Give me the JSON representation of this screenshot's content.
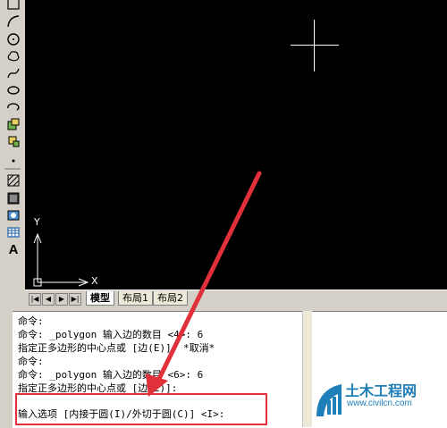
{
  "toolbar": {
    "items": [
      "line-icon",
      "arc-icon",
      "circle-icon",
      "cloud-icon",
      "spline-icon",
      "ellipse-icon",
      "ellipse-arc-icon",
      "insert-block-icon",
      "make-block-icon",
      "point-icon",
      "hatch-icon",
      "gradient-icon",
      "region-icon",
      "table-icon",
      "multiline-text-icon"
    ],
    "text_tool_label": "A"
  },
  "drawing": {
    "ucs_x_label": "X",
    "ucs_y_label": "Y",
    "background": "#000000"
  },
  "tabs": {
    "nav": [
      "|◀",
      "◀",
      "▶",
      "▶|"
    ],
    "items": [
      "模型",
      "布局1",
      "布局2"
    ],
    "active": "模型"
  },
  "command": {
    "lines": [
      "命令:",
      "命令: _polygon 输入边的数目 <4>: 6",
      "指定正多边形的中心点或 [边(E)]: *取消*",
      "命令:",
      "命令: _polygon 输入边的数目 <6>: 6",
      "指定正多边形的中心点或 [边(E)]:"
    ],
    "prompt": "输入选项 [内接于圆(I)/外切于圆(C)] <I>:"
  },
  "annotation": {
    "color": "#e0303a"
  },
  "logo": {
    "title": "土木工程网",
    "url": "www.civilcn.com"
  }
}
